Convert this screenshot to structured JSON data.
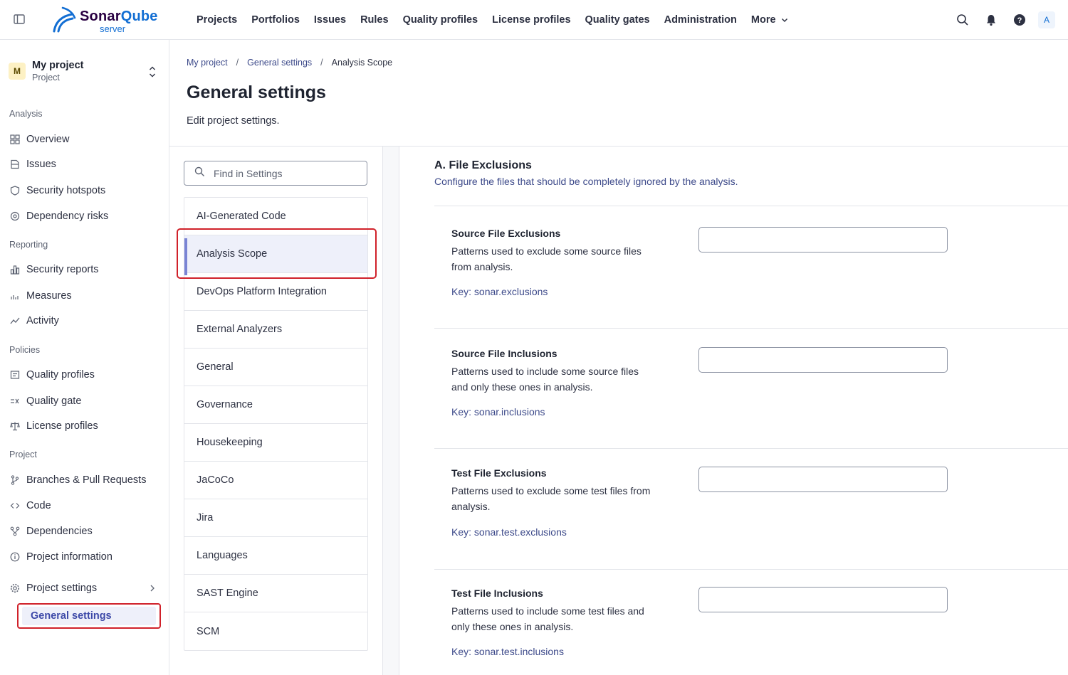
{
  "app": {
    "logo_main": "Sonar",
    "logo_accent": "Qube",
    "logo_sub": "server"
  },
  "nav": {
    "items": [
      "Projects",
      "Portfolios",
      "Issues",
      "Rules",
      "Quality profiles",
      "License profiles",
      "Quality gates",
      "Administration"
    ],
    "more_label": "More",
    "user_initial": "A"
  },
  "project": {
    "initial": "M",
    "name": "My project",
    "type": "Project"
  },
  "sidebar": {
    "sections": {
      "analysis": "Analysis",
      "reporting": "Reporting",
      "policies": "Policies",
      "project": "Project"
    },
    "items": {
      "overview": "Overview",
      "issues": "Issues",
      "security_hotspots": "Security hotspots",
      "dependency_risks": "Dependency risks",
      "security_reports": "Security reports",
      "measures": "Measures",
      "activity": "Activity",
      "quality_profiles": "Quality profiles",
      "quality_gate": "Quality gate",
      "license_profiles": "License profiles",
      "branches": "Branches & Pull Requests",
      "code": "Code",
      "dependencies": "Dependencies",
      "project_information": "Project information",
      "project_settings": "Project settings",
      "general_settings": "General settings"
    }
  },
  "breadcrumb": [
    "My project",
    "General settings",
    "Analysis Scope"
  ],
  "page": {
    "title": "General settings",
    "description": "Edit project settings."
  },
  "search": {
    "placeholder": "Find in Settings"
  },
  "categories": [
    "AI-Generated Code",
    "Analysis Scope",
    "DevOps Platform Integration",
    "External Analyzers",
    "General",
    "Governance",
    "Housekeeping",
    "JaCoCo",
    "Jira",
    "Languages",
    "SAST Engine",
    "SCM"
  ],
  "active_category": "Analysis Scope",
  "section": {
    "title": "A. File Exclusions",
    "description": "Configure the files that should be completely ignored by the analysis."
  },
  "settings": [
    {
      "name": "Source File Exclusions",
      "desc_line1": "Patterns used to exclude some source files",
      "desc_line2": "from analysis.",
      "key": "Key: sonar.exclusions",
      "value": ""
    },
    {
      "name": "Source File Inclusions",
      "desc_line1": "Patterns used to include some source files",
      "desc_line2": "and only these ones in analysis.",
      "key": "Key: sonar.inclusions",
      "value": ""
    },
    {
      "name": "Test File Exclusions",
      "desc_line1": "Patterns used to exclude some test files from",
      "desc_line2": "analysis.",
      "key": "Key: sonar.test.exclusions",
      "value": ""
    },
    {
      "name": "Test File Inclusions",
      "desc_line1": "Patterns used to include some test files and",
      "desc_line2": "only these ones in analysis.",
      "key": "Key: sonar.test.inclusions",
      "value": ""
    }
  ],
  "colors": {
    "accent": "#3d49a8",
    "brand": "#126ed3",
    "highlight": "#d0212a"
  }
}
